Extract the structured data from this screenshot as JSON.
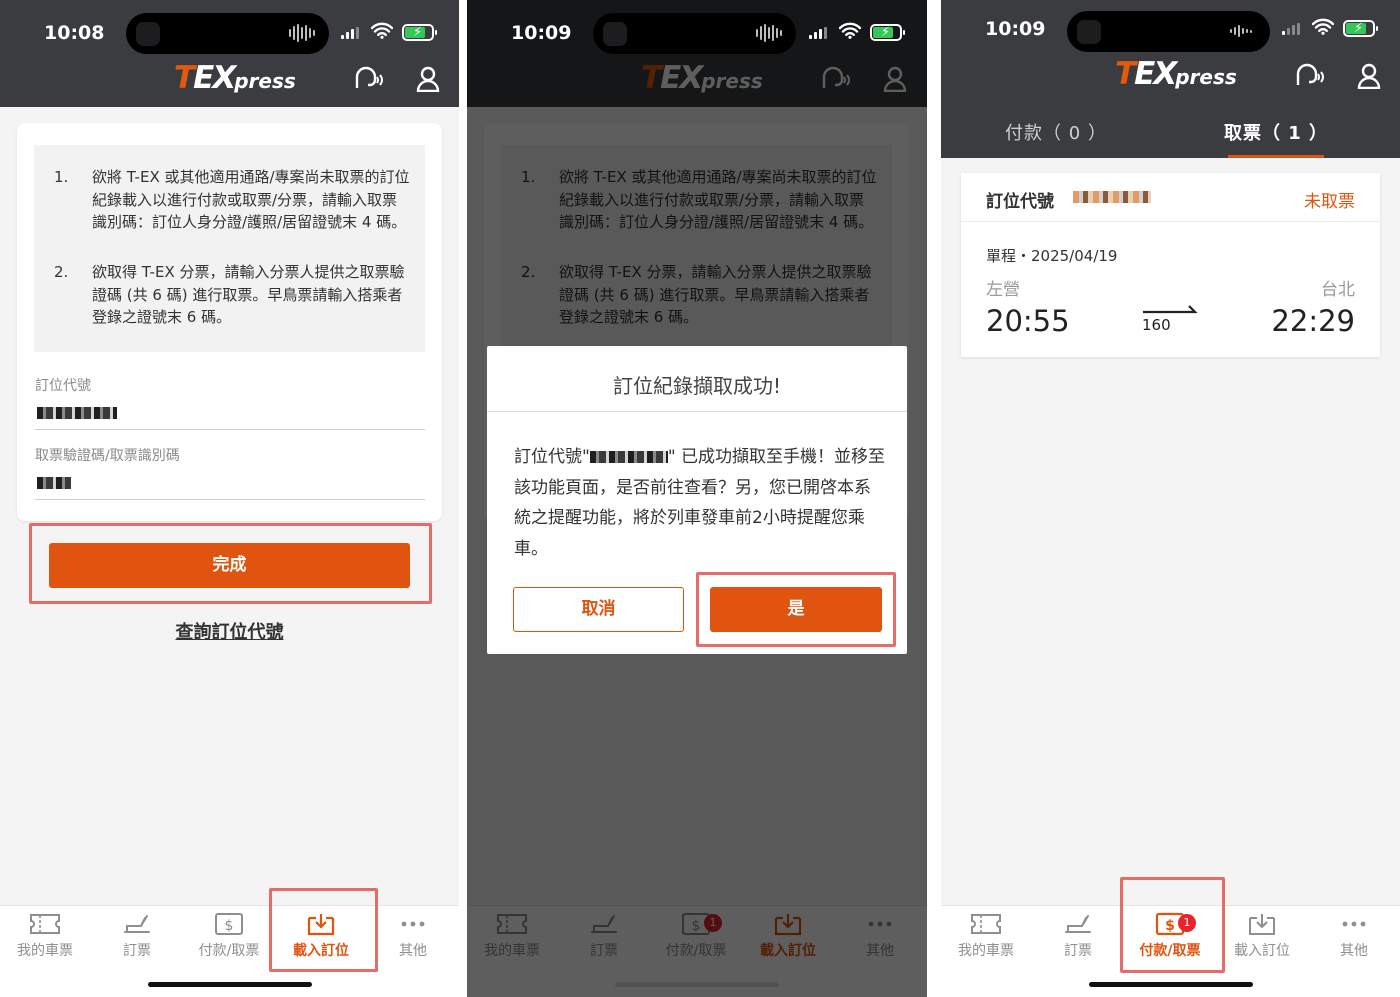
{
  "brand": {
    "logo_t": "T",
    "logo_ex": "EX",
    "logo_press": "press"
  },
  "tabs": {
    "my_tickets": "我的車票",
    "book": "訂票",
    "pay_pickup": "付款/取票",
    "load_booking": "載入訂位",
    "more": "其他"
  },
  "panel1": {
    "time": "10:08",
    "notice": [
      {
        "num": "1.",
        "text": "欲將 T-EX 或其他適用通路/專案尚未取票的訂位紀錄載入以進行付款或取票/分票，請輸入取票識別碼：訂位人身分證/護照/居留證號末 4 碼。"
      },
      {
        "num": "2.",
        "text": "欲取得 T-EX 分票，請輸入分票人提供之取票驗證碼 (共 6 碼) 進行取票。早鳥票請輸入搭乘者登錄之證號末 6 碼。"
      }
    ],
    "booking_code_label": "訂位代號",
    "verify_code_label": "取票驗證碼/取票識別碼",
    "done_button": "完成",
    "lookup_link": "查詢訂位代號"
  },
  "panel2": {
    "time": "10:09",
    "dialog_title": "訂位紀錄擷取成功!",
    "dialog_msg_prefix": "訂位代號\"",
    "dialog_msg_suffix": "\" 已成功擷取至手機！並移至該功能頁面，是否前往查看？另，您已開啓本系統之提醒功能，將於列車發車前2小時提醒您乘車。",
    "cancel_button": "取消",
    "yes_button": "是",
    "pay_badge": "1"
  },
  "panel3": {
    "time": "10:09",
    "tab_pay": "付款（ 0 ）",
    "tab_pickup": "取票（ 1 ）",
    "code_label": "訂位代號",
    "status": "未取票",
    "trip": "單程・2025/04/19",
    "from": "左營",
    "to": "台北",
    "departure": "20:55",
    "arrival": "22:29",
    "train_no": "160",
    "pay_badge": "1"
  },
  "colors": {
    "accent": "#e0540f",
    "header": "#3a3c3f",
    "highlight": "#e46d6a",
    "badge": "#e8242a"
  }
}
